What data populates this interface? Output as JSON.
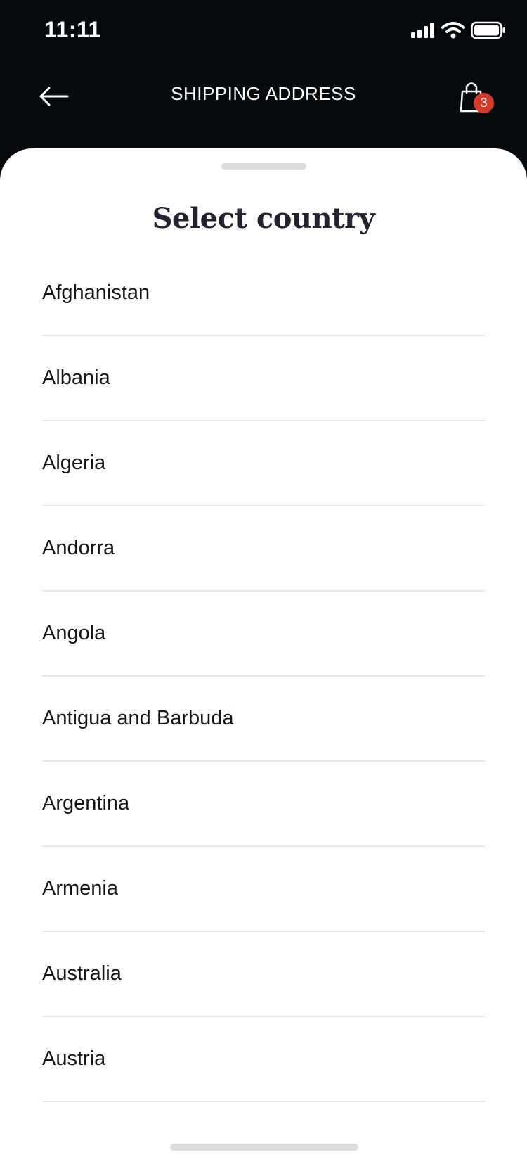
{
  "status_bar": {
    "time": "11:11",
    "icons": [
      "cellular-signal-icon",
      "wifi-icon",
      "battery-icon"
    ]
  },
  "nav": {
    "back_icon": "arrow-left-icon",
    "title": "SHIPPING ADDRESS",
    "cart_icon": "shopping-bag-icon",
    "cart_count": "3"
  },
  "sheet": {
    "title": "Select country",
    "countries": [
      "Afghanistan",
      "Albania",
      "Algeria",
      "Andorra",
      "Angola",
      "Antigua and Barbuda",
      "Argentina",
      "Armenia",
      "Australia",
      "Austria"
    ]
  },
  "colors": {
    "header_background": "#060a0c",
    "sheet_background": "#ffffff",
    "badge": "#d23a2c",
    "title_text": "#232330",
    "divider": "#e6e6e6"
  }
}
